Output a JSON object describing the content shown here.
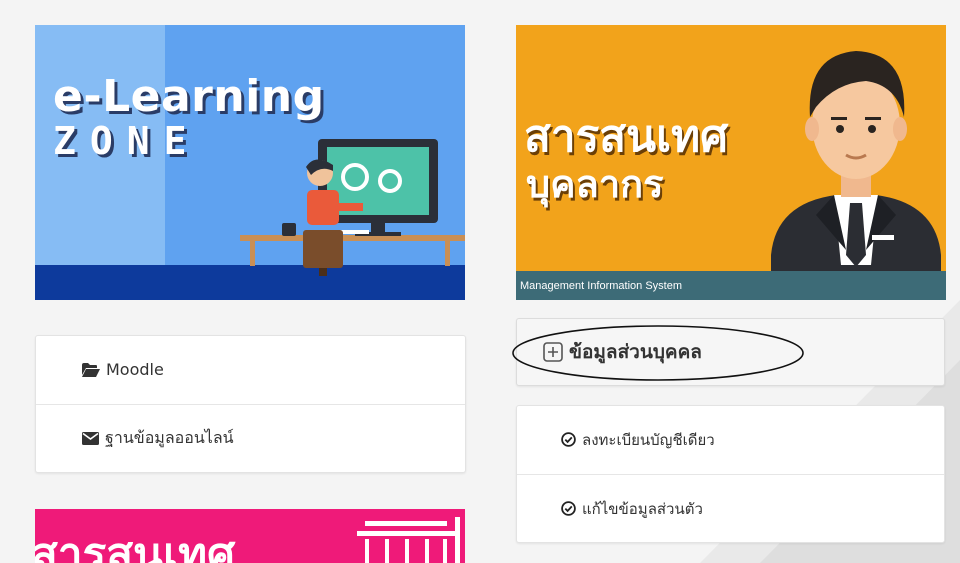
{
  "elearning_banner": {
    "title": "e-Learning",
    "subtitle": "ZONE"
  },
  "personnel_banner": {
    "title_line1": "สารสนเทศ",
    "title_line2": "บุคลากร",
    "footer": "Management Information System"
  },
  "left_menu": {
    "items": [
      {
        "label": "Moodle",
        "icon": "folder-open-icon"
      },
      {
        "label": "ฐานข้อมูลออนไลน์",
        "icon": "envelope-icon"
      }
    ]
  },
  "personal_info": {
    "header_label": "ข้อมูลส่วนบุคคล",
    "header_icon": "plus-square-icon",
    "items": [
      {
        "label": "ลงทะเบียนบัญชีเดียว",
        "icon": "check-circle-icon"
      },
      {
        "label": "แก้ไขข้อมูลส่วนตัว",
        "icon": "check-circle-icon"
      }
    ]
  },
  "bottom_banner": {
    "title": "สารสนเทศ"
  },
  "colors": {
    "elearning_bg": "#5fa2f0",
    "elearning_bar": "#0d3a9c",
    "personnel_bg": "#f2a31b",
    "personnel_footer": "#3d6b77",
    "pink_banner": "#ef1a79"
  }
}
